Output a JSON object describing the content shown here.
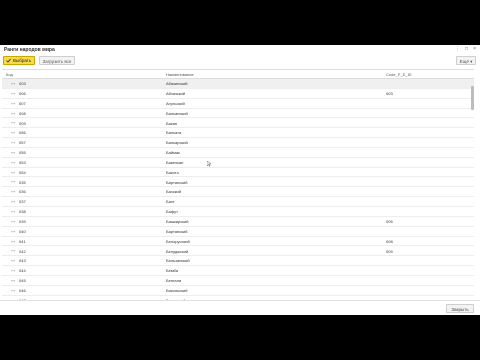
{
  "window": {
    "title": "Ранги народов мира",
    "controls": [
      "⋮",
      "□",
      "×"
    ]
  },
  "toolbar": {
    "select_label": "Выбрать",
    "load_label": "Загрузить все",
    "more_label": "Ещё ▾"
  },
  "table": {
    "columns": [
      "Код",
      "Наименование",
      "Code_P_E_ID"
    ],
    "rows": [
      {
        "code": "003",
        "name": "Абазинский",
        "extra": ""
      },
      {
        "code": "006",
        "name": "Абхазский",
        "extra": "003"
      },
      {
        "code": "007",
        "name": "Агульский",
        "extra": ""
      },
      {
        "code": "008",
        "name": "Балканский",
        "extra": ""
      },
      {
        "code": "009",
        "name": "Бакан",
        "extra": ""
      },
      {
        "code": "056",
        "name": "Балката",
        "extra": ""
      },
      {
        "code": "057",
        "name": "Балкарский",
        "extra": ""
      },
      {
        "code": "055",
        "name": "Баймак",
        "extra": ""
      },
      {
        "code": "053",
        "name": "Бакелкан",
        "extra": ""
      },
      {
        "code": "054",
        "name": "Бакото",
        "extra": ""
      },
      {
        "code": "035",
        "name": "Бартанский",
        "extra": ""
      },
      {
        "code": "036",
        "name": "Бахский",
        "extra": ""
      },
      {
        "code": "037",
        "name": "Бахт",
        "extra": ""
      },
      {
        "code": "038",
        "name": "Бафут",
        "extra": ""
      },
      {
        "code": "039",
        "name": "Башкирский",
        "extra": "005"
      },
      {
        "code": "040",
        "name": "Бартанский",
        "extra": ""
      },
      {
        "code": "041",
        "name": "Белорусский",
        "extra": "008"
      },
      {
        "code": "042",
        "name": "Белуджский",
        "extra": "009"
      },
      {
        "code": "043",
        "name": "Бельзанский",
        "extra": ""
      },
      {
        "code": "044",
        "name": "Бемба",
        "extra": ""
      },
      {
        "code": "045",
        "name": "Бенгали",
        "extra": ""
      },
      {
        "code": "046",
        "name": "Бикольский",
        "extra": ""
      },
      {
        "code": "047",
        "name": "Бихарский",
        "extra": ""
      },
      {
        "code": "048",
        "name": "Бини",
        "extra": ""
      },
      {
        "code": "049",
        "name": "Бирманский",
        "extra": ""
      }
    ],
    "expand_glyph": "⊶"
  },
  "footer": {
    "close_label": "Закрыть"
  },
  "colors": {
    "accent": "#f5d94e",
    "accent_border": "#c9a800",
    "background": "#000000"
  },
  "icons": {
    "select": "check-icon",
    "close": "close-icon"
  }
}
